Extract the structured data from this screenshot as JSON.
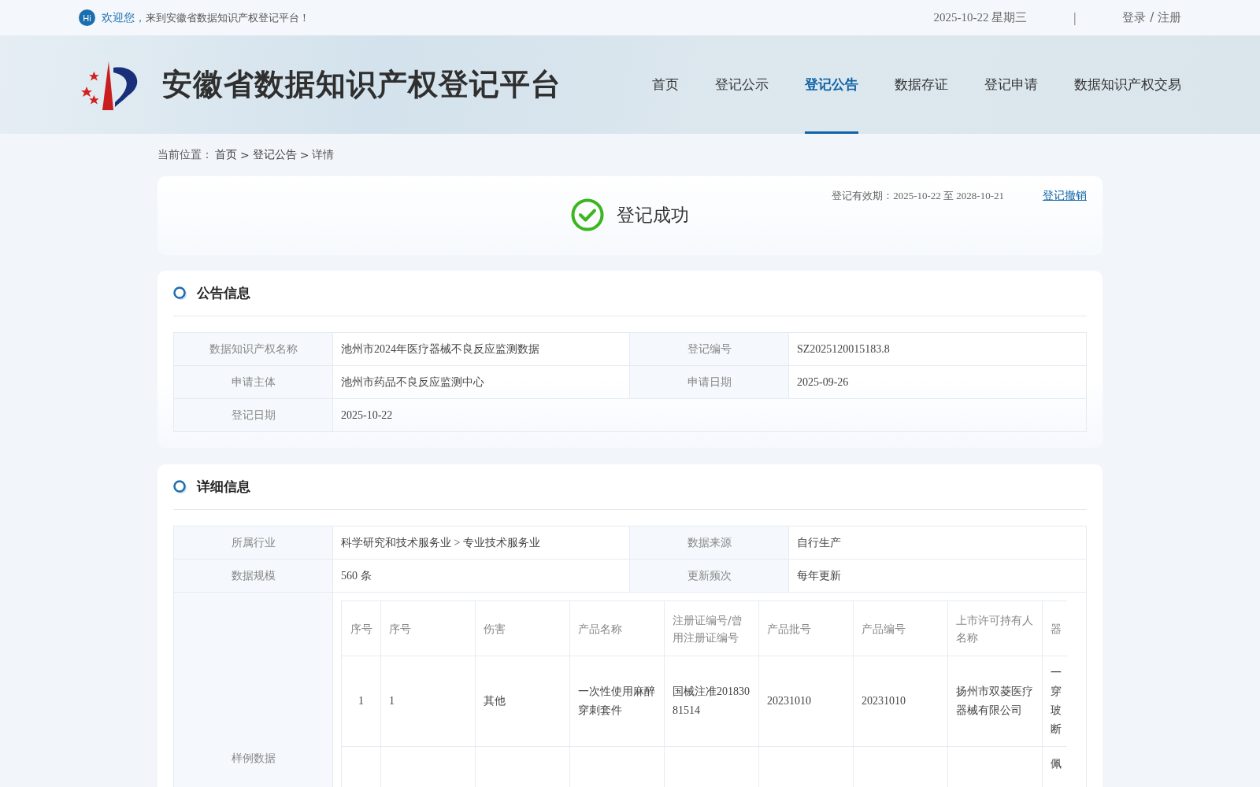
{
  "top_bar": {
    "greeting_badge": "Hi",
    "greeting": "欢迎您，",
    "welcome": "来到安徽省数据知识产权登记平台！",
    "date": "2025-10-22 星期三",
    "divider": "|",
    "login": "登录 / 注册"
  },
  "header": {
    "site_title": "安徽省数据知识产权登记平台",
    "nav": [
      {
        "label": "首页",
        "selected": false
      },
      {
        "label": "登记公示",
        "selected": false
      },
      {
        "label": "登记公告",
        "selected": true
      },
      {
        "label": "数据存证",
        "selected": false
      },
      {
        "label": "登记申请",
        "selected": false
      },
      {
        "label": "数据知识产权交易",
        "selected": false
      }
    ]
  },
  "breadcrumb": {
    "label": "当前位置：",
    "items": [
      {
        "kind": "link",
        "text": "首页"
      },
      {
        "kind": "separator",
        "text": ">"
      },
      {
        "kind": "link",
        "text": "登记公告"
      },
      {
        "kind": "separator",
        "text": ">"
      },
      {
        "kind": "text",
        "text": "详情"
      }
    ]
  },
  "status": {
    "title": "登记成功",
    "validity_label": "登记有效期：",
    "validity_from": "2025-10-22",
    "validity_to_word": "至",
    "validity_to": "2028-10-21",
    "revoke": "登记撤销"
  },
  "notice": {
    "title": "公告信息",
    "rows": [
      {
        "cells": [
          {
            "label": "数据知识产权名称",
            "value": "池州市2024年医疗器械不良反应监测数据"
          },
          {
            "label": "登记编号",
            "value": "SZ2025120015183.8"
          }
        ]
      },
      {
        "cells": [
          {
            "label": "申请主体",
            "value": "池州市药品不良反应监测中心"
          },
          {
            "label": "申请日期",
            "value": "2025-09-26"
          }
        ]
      },
      {
        "cells": [
          {
            "label": "登记日期",
            "value": "2025-10-22"
          }
        ]
      }
    ]
  },
  "details": {
    "title": "详细信息",
    "rows": [
      {
        "cells": [
          {
            "label": "所属行业",
            "value": "科学研究和技术服务业 > 专业技术服务业"
          },
          {
            "label": "数据来源",
            "value": "自行生产"
          }
        ]
      },
      {
        "cells": [
          {
            "label": "数据规模",
            "value": "560 条"
          },
          {
            "label": "更新频次",
            "value": "每年更新"
          }
        ]
      }
    ],
    "sample_label": "样例数据",
    "sample_table": {
      "columns": [
        "序号",
        "序号",
        "伤害",
        "产品名称",
        "注册证编号/曾用注册证编号",
        "产品批号",
        "产品编号",
        "上市许可持有人名称",
        "器"
      ],
      "rows": [
        [
          "1",
          "1",
          "其他",
          "一次性使用麻醉穿刺套件",
          "国械注准20183081514",
          "20231010",
          "20231010",
          "扬州市双菱医疗器械有限公司",
          "一穿玻断"
        ],
        [
          "",
          "",
          "",
          "",
          "",
          "",
          "",
          "",
          "佩"
        ]
      ]
    }
  }
}
